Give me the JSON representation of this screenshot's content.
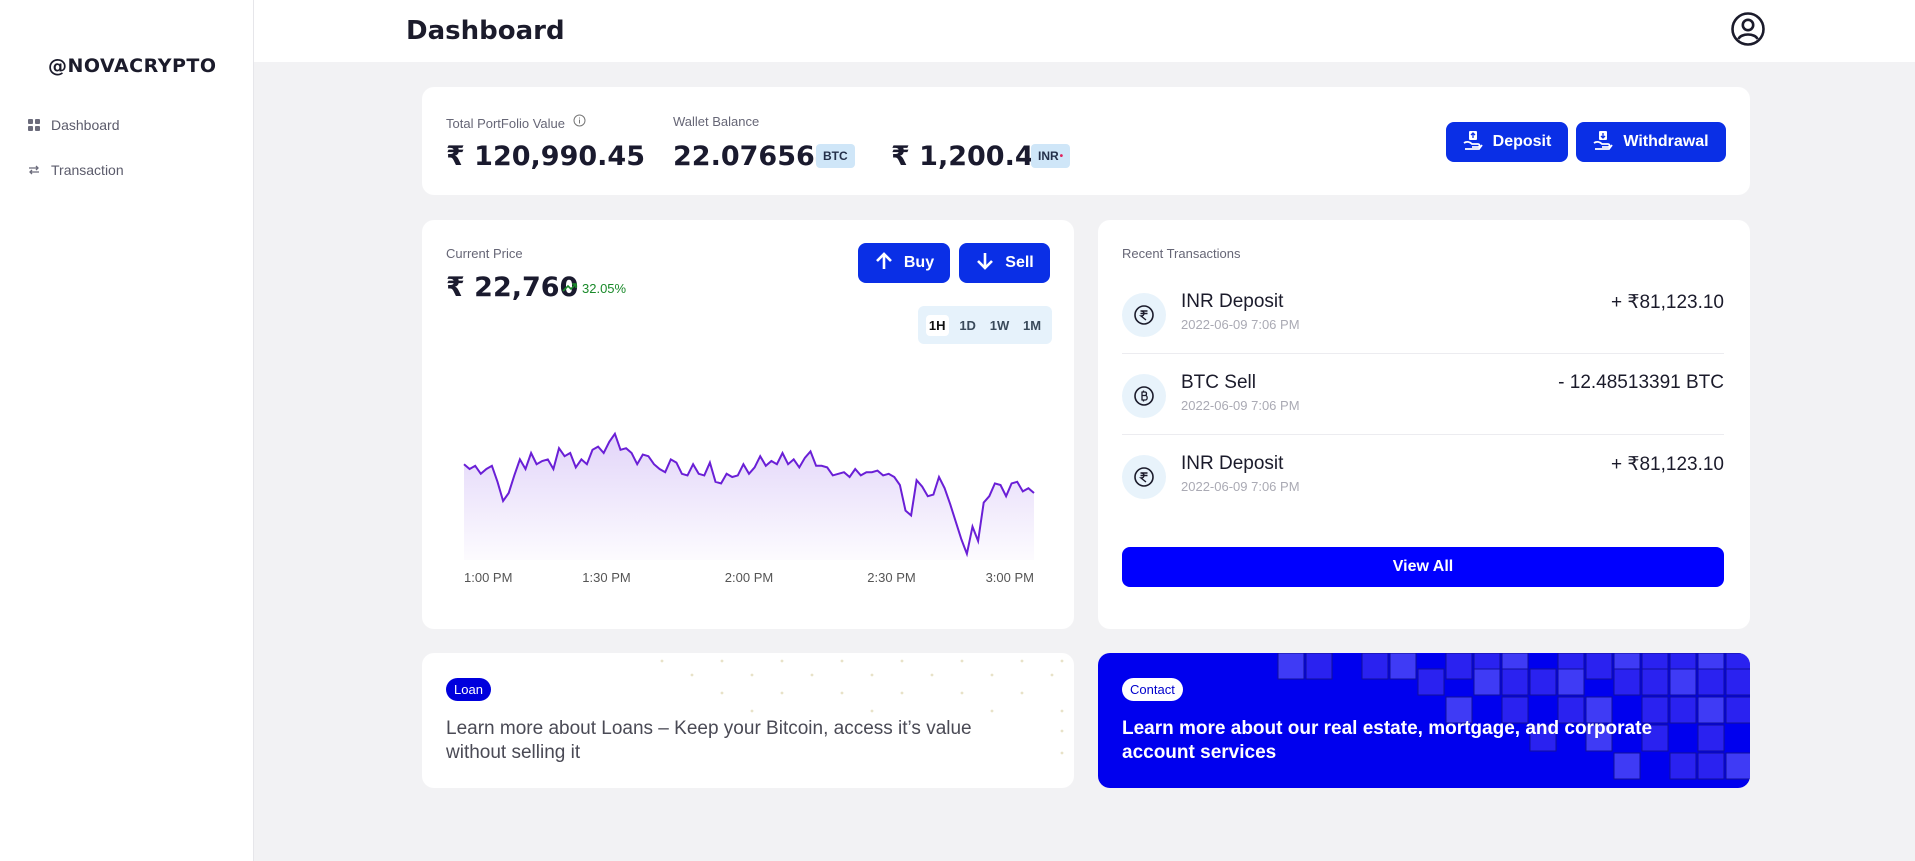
{
  "sidebar": {
    "brand": "@NOVACRYPTO",
    "items": [
      {
        "label": "Dashboard",
        "icon": "grid-icon"
      },
      {
        "label": "Transaction",
        "icon": "swap-arrows-icon"
      }
    ]
  },
  "header": {
    "title": "Dashboard",
    "user_icon": "user-circle-icon"
  },
  "portfolio": {
    "total_label": "Total PortFolio Value",
    "total_value": "₹ 120,990.45",
    "wallet_label": "Wallet Balance",
    "btc_value": "22.076564",
    "btc_badge": "BTC",
    "inr_value": "₹ 1,200.45",
    "inr_badge": "INR",
    "deposit_label": "Deposit",
    "withdrawal_label": "Withdrawal"
  },
  "price": {
    "label": "Current Price",
    "value": "₹ 22,760",
    "change": "32.05%",
    "buy_label": "Buy",
    "sell_label": "Sell",
    "ranges": [
      "1H",
      "1D",
      "1W",
      "1M"
    ],
    "active_range": "1H"
  },
  "chart_data": {
    "type": "area",
    "x_ticks": [
      "1:00 PM",
      "1:30 PM",
      "2:00 PM",
      "2:30 PM",
      "3:00 PM"
    ],
    "values": [
      63,
      60,
      62,
      57,
      60,
      62,
      52,
      40,
      45,
      56,
      66,
      60,
      70,
      63,
      65,
      66,
      60,
      73,
      68,
      70,
      61,
      66,
      63,
      72,
      74,
      70,
      77,
      82,
      72,
      73,
      70,
      63,
      69,
      68,
      63,
      60,
      58,
      66,
      64,
      57,
      56,
      63,
      57,
      56,
      64,
      52,
      51,
      57,
      55,
      56,
      63,
      57,
      61,
      68,
      62,
      65,
      63,
      70,
      63,
      66,
      61,
      67,
      71,
      62,
      62,
      61,
      56,
      57,
      58,
      55,
      60,
      56,
      58,
      58,
      59,
      56,
      57,
      55,
      50,
      34,
      31,
      53,
      49,
      43,
      44,
      55,
      48,
      38,
      27,
      16,
      7,
      24,
      15,
      39,
      43,
      51,
      50,
      43,
      51,
      52,
      46,
      48,
      45
    ],
    "color": "#6a1fd6"
  },
  "transactions": {
    "title": "Recent Transactions",
    "items": [
      {
        "name": "INR Deposit",
        "date": "2022-06-09 7:06 PM",
        "amount": "+ ₹81,123.10",
        "icon": "rupee-icon"
      },
      {
        "name": "BTC Sell",
        "date": "2022-06-09 7:06 PM",
        "amount": "- 12.48513391 BTC",
        "icon": "bitcoin-icon"
      },
      {
        "name": "INR Deposit",
        "date": "2022-06-09 7:06 PM",
        "amount": "+ ₹81,123.10",
        "icon": "rupee-icon"
      }
    ],
    "view_all_label": "View All"
  },
  "promos": {
    "loan": {
      "tag": "Loan",
      "text": "Learn more about Loans – Keep your Bitcoin, access it’s value without selling it"
    },
    "contact": {
      "tag": "Contact",
      "text": "Learn more about our real estate, mortgage, and corporate account services"
    }
  },
  "colors": {
    "accent": "#0a2fe6",
    "view_all": "#0000ff",
    "contact_bg": "#0000ee",
    "positive": "#1a8a2a"
  }
}
